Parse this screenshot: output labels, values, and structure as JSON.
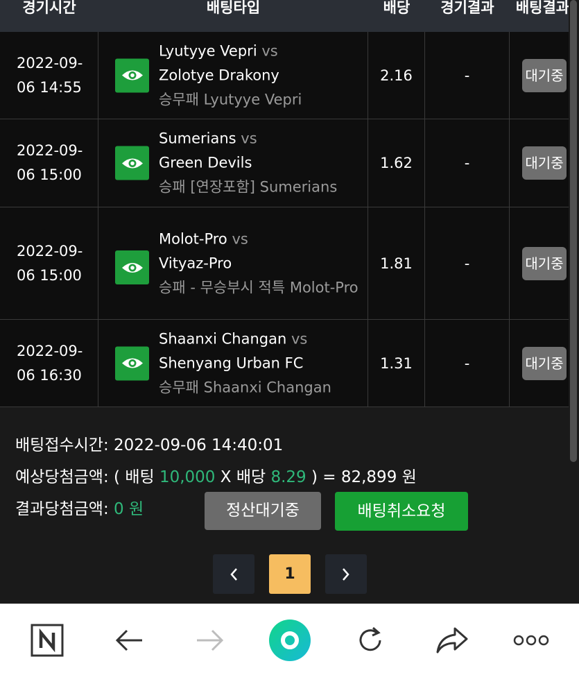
{
  "table": {
    "headers": [
      "경기시간",
      "배팅타입",
      "배당",
      "경기결과",
      "배팅결과"
    ],
    "rows": [
      {
        "time": "2022-09-06 14:55",
        "home": "Lyutyye Vepri",
        "vs": "vs",
        "away": "Zolotye Drakony",
        "bet_type": "승무패 Lyutyye Vepri",
        "odds": "2.16",
        "result": "-",
        "status": "대기중"
      },
      {
        "time": "2022-09-06 15:00",
        "home": "Sumerians",
        "vs": "vs",
        "away": "Green Devils",
        "bet_type": "승패 [연장포함] Sumerians",
        "odds": "1.62",
        "result": "-",
        "status": "대기중"
      },
      {
        "time": "2022-09-06 15:00",
        "home": "Molot-Pro",
        "vs": "vs",
        "away": "Vityaz-Pro",
        "bet_type": "승패 - 무승부시 적특 Molot-Pro",
        "odds": "1.81",
        "result": "-",
        "status": "대기중"
      },
      {
        "time": "2022-09-06 16:30",
        "home": "Shaanxi Changan",
        "vs": "vs",
        "away": "Shenyang Urban FC",
        "bet_type": "승무패 Shaanxi Changan",
        "odds": "1.31",
        "result": "-",
        "status": "대기중"
      }
    ]
  },
  "summary": {
    "time_label": "배팅접수시간:",
    "time_value": "2022-09-06 14:40:01",
    "expected_label": "예상당첨금액:",
    "expected_open": "( 배팅",
    "bet_amount": "10,000",
    "times": "X 배당",
    "total_odds": "8.29",
    "expected_close": ") = 82,899 원",
    "result_label": "결과당첨금액:",
    "result_value": "0 원"
  },
  "buttons": {
    "settle": "정산대기중",
    "cancel": "배팅취소요청"
  },
  "pagination": {
    "prev": "‹",
    "current": "1",
    "next": "›"
  },
  "colors": {
    "accent_green": "#1e9e3c",
    "value_green": "#2fb87a",
    "page_active": "#f6bd60",
    "background": "#1a1a1a"
  },
  "browser_bar": {
    "icons": [
      "naver-n-icon",
      "back-arrow-icon",
      "forward-arrow-icon",
      "home-circle-icon",
      "refresh-icon",
      "share-icon",
      "more-icon"
    ]
  }
}
